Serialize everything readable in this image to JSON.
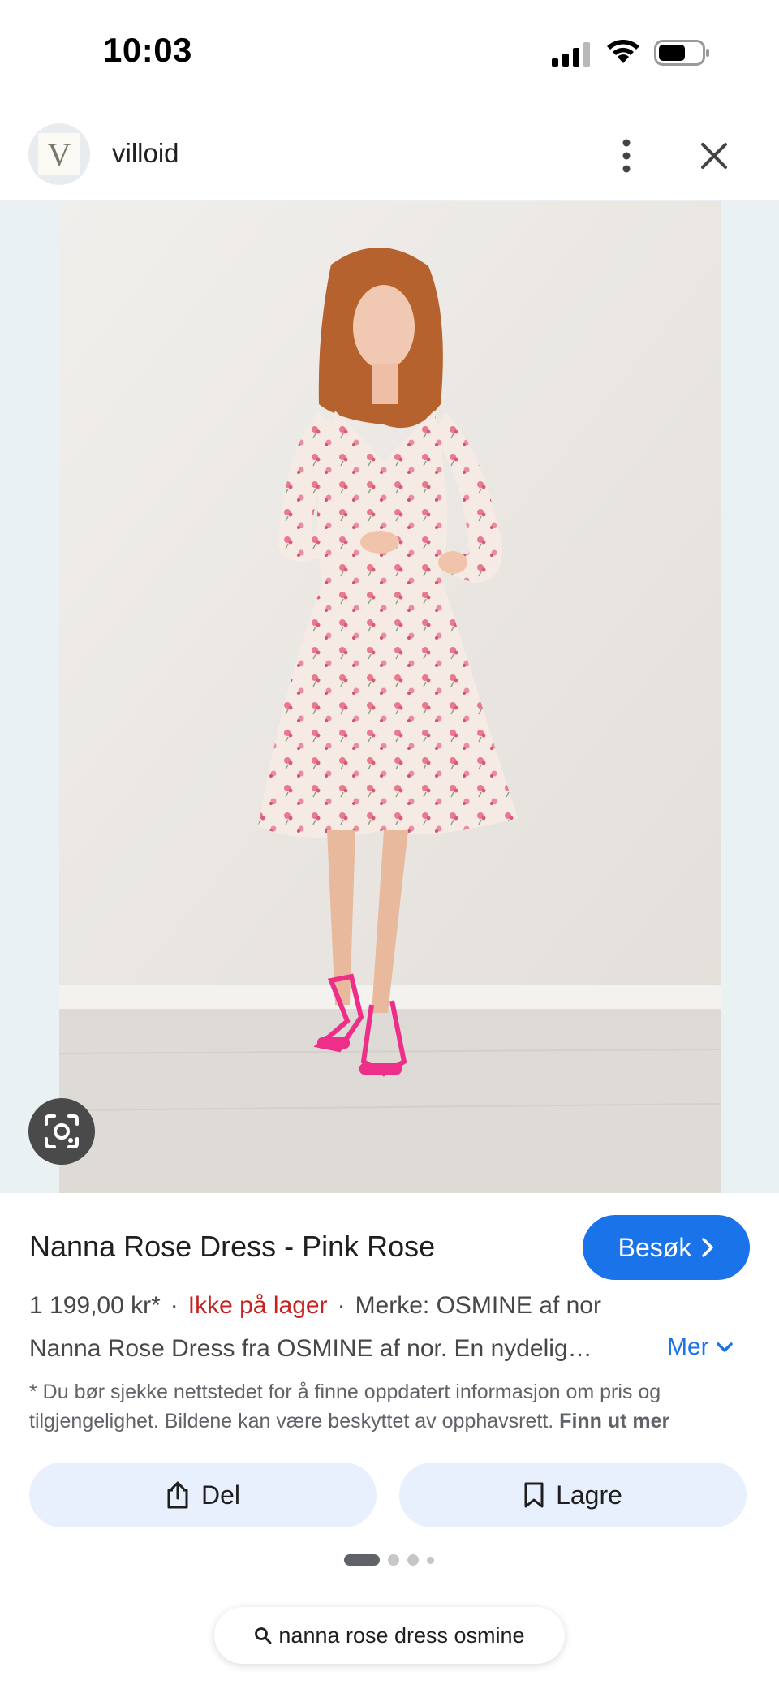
{
  "status_bar": {
    "time": "10:03"
  },
  "header": {
    "site_name": "villoid",
    "avatar_letter": "V"
  },
  "product": {
    "title": "Nanna Rose Dress - Pink Rose",
    "visit_label": "Besøk",
    "price": "1 199,00 kr*",
    "stock": "Ikke på lager",
    "brand": "Merke: OSMINE af nor",
    "description": "Nanna Rose Dress fra OSMINE af nor. En nydelig…",
    "more_label": "Mer",
    "disclaimer": "* Du bør sjekke nettstedet for å finne oppdatert informasjon om pris og tilgjengelighet. Bildene kan være beskyttet av opphavsrett.",
    "learn_more": "Finn ut mer"
  },
  "actions": {
    "share_label": "Del",
    "save_label": "Lagre"
  },
  "pagination": {
    "count": 4,
    "active": 0
  },
  "search": {
    "query": "nanna rose dress osmine"
  },
  "colors": {
    "accent": "#1a73e8",
    "out_of_stock": "#c5221f",
    "button_bg": "#e8f0fe"
  }
}
